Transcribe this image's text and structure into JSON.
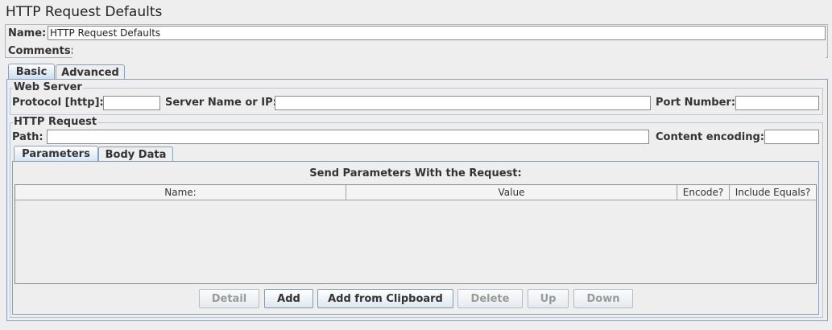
{
  "window": {
    "title": "HTTP Request Defaults"
  },
  "name_row": {
    "label": "Name:",
    "value": "HTTP Request Defaults"
  },
  "comments_row": {
    "label": "Comments:",
    "value": ""
  },
  "main_tabs": [
    {
      "label": "Basic",
      "active": true
    },
    {
      "label": "Advanced",
      "active": false
    }
  ],
  "web_server": {
    "legend": "Web Server",
    "protocol_label": "Protocol [http]:",
    "protocol_value": "",
    "server_label": "Server Name or IP:",
    "server_value": "",
    "port_label": "Port Number:",
    "port_value": ""
  },
  "http_request": {
    "legend": "HTTP Request",
    "path_label": "Path:",
    "path_value": "",
    "encoding_label": "Content encoding:",
    "encoding_value": ""
  },
  "sub_tabs": [
    {
      "label": "Parameters",
      "active": true
    },
    {
      "label": "Body Data",
      "active": false
    }
  ],
  "parameters": {
    "heading": "Send Parameters With the Request:",
    "columns": [
      "Name:",
      "Value",
      "Encode?",
      "Include Equals?"
    ],
    "rows": []
  },
  "buttons": [
    {
      "label": "Detail",
      "enabled": false
    },
    {
      "label": "Add",
      "enabled": true
    },
    {
      "label": "Add from Clipboard",
      "enabled": true
    },
    {
      "label": "Delete",
      "enabled": false
    },
    {
      "label": "Up",
      "enabled": false
    },
    {
      "label": "Down",
      "enabled": false
    }
  ]
}
